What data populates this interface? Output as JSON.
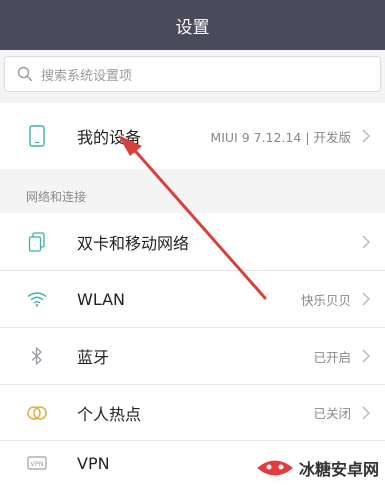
{
  "header": {
    "title": "设置"
  },
  "search": {
    "placeholder": "搜索系统设置项"
  },
  "device_row": {
    "label": "我的设备",
    "value": "MIUI 9 7.12.14 | 开发版",
    "icon": "phone-icon"
  },
  "section_network": {
    "title": "网络和连接"
  },
  "network_rows": [
    {
      "label": "双卡和移动网络",
      "value": "",
      "icon": "sim-cards-icon"
    },
    {
      "label": "WLAN",
      "value": "快乐贝贝",
      "icon": "wifi-icon"
    },
    {
      "label": "蓝牙",
      "value": "已开启",
      "icon": "bluetooth-icon"
    },
    {
      "label": "个人热点",
      "value": "已关闭",
      "icon": "hotspot-icon"
    },
    {
      "label": "VPN",
      "value": "",
      "icon": "vpn-icon"
    }
  ],
  "watermark": {
    "text": "冰糖安卓网"
  },
  "colors": {
    "titlebar": "#4a4a5a",
    "accent_icon": "#3bb3a8",
    "arrow": "#d9403a"
  }
}
